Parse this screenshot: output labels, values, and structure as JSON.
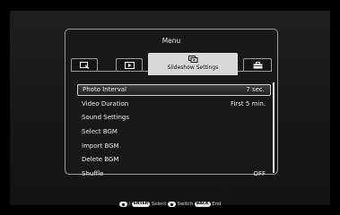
{
  "menu": {
    "title": "Menu",
    "tabs": [
      {
        "icon": "zoom-frame-icon",
        "active": false
      },
      {
        "icon": "play-icon",
        "active": false
      },
      {
        "icon": "slideshow-icon",
        "label": "Slideshow Settings",
        "active": true
      },
      {
        "icon": "toolbox-icon",
        "active": false
      }
    ],
    "items": [
      {
        "label": "Photo Interval",
        "value": "7 sec."
      },
      {
        "label": "Video Duration",
        "value": "First 5 min."
      },
      {
        "label": "Sound Settings",
        "value": ""
      },
      {
        "label": "Select BGM",
        "value": ""
      },
      {
        "label": "Import BGM",
        "value": ""
      },
      {
        "label": "Delete BGM",
        "value": ""
      },
      {
        "label": "Shuffle",
        "value": "OFF"
      }
    ],
    "selected_index": 0
  },
  "guide": {
    "separator": "/",
    "enter_key": "ENTER",
    "select_label": "Select",
    "switch_label": "Switch",
    "back_key": "BACK",
    "end_label": "End"
  }
}
